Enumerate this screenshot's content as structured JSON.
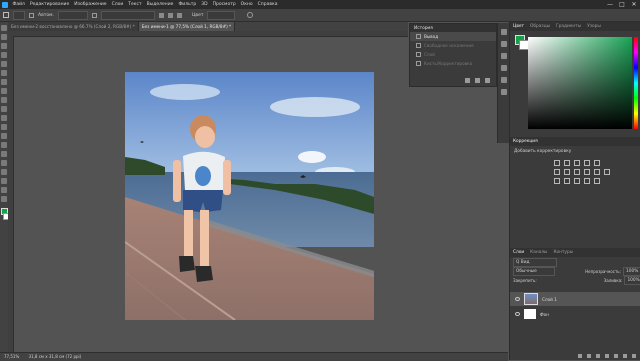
{
  "menubar": {
    "items": [
      "Файл",
      "Редактирование",
      "Изображение",
      "Слои",
      "Текст",
      "Выделение",
      "Фильтр",
      "3D",
      "Просмотр",
      "Окно",
      "Справка"
    ],
    "controls": [
      "—",
      "□",
      "✕"
    ]
  },
  "options": {
    "auto_label": "Автом.",
    "color_label": "Цвет",
    "color_value": ""
  },
  "tabs": [
    {
      "label": "Без имени-2 восстановлено @ 66.7% (Слой 2, RGB/8#) *"
    },
    {
      "label": "Без имени-1 @ 77,5% (Слой 1, RGB/8#) *"
    }
  ],
  "history": {
    "title": "История",
    "items": [
      {
        "label": "Вывод",
        "state": "current"
      },
      {
        "label": "Свободное искажение",
        "state": "undone"
      },
      {
        "label": "Слой",
        "state": "undone"
      },
      {
        "label": "Кисть/Корректировка",
        "state": "undone"
      }
    ]
  },
  "color_panel": {
    "tabs": [
      "Цвет",
      "Образцы",
      "Градиенты",
      "Узоры"
    ],
    "foreground": "#17a24a",
    "background": "#ffffff",
    "hue": "#19a356"
  },
  "adjustments": {
    "tabs": [
      "Коррекция"
    ],
    "label": "Добавить корректировку"
  },
  "layers": {
    "tabs": [
      "Слои",
      "Каналы",
      "Контуры"
    ],
    "filter_label": "Q Вид",
    "blend_mode": "Обычные",
    "opacity_label": "Непрозрачность:",
    "opacity": "100%",
    "lock_label": "Закрепить:",
    "fill_label": "Заливка:",
    "fill": "100%",
    "items": [
      {
        "name": "Слой 1"
      },
      {
        "name": "Фон"
      }
    ]
  },
  "status": {
    "zoom": "77,51%",
    "doc_size": "31,8 см x 31,8 см (72 ppi)"
  }
}
